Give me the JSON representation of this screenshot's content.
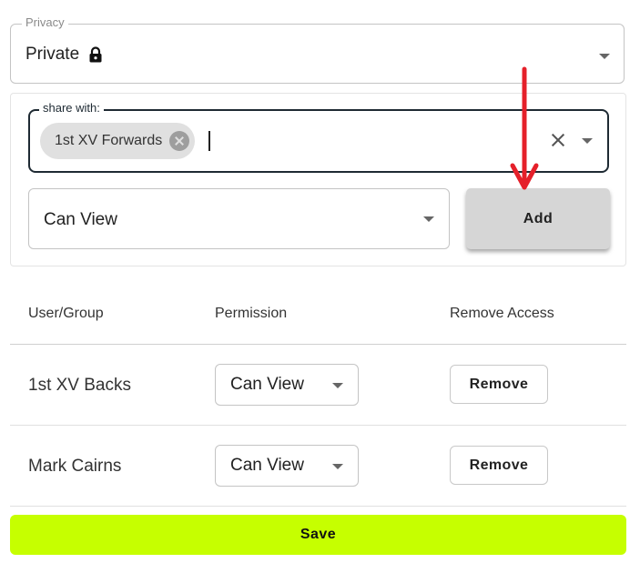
{
  "privacy": {
    "legend": "Privacy",
    "value": "Private",
    "icon": "lock-icon"
  },
  "share_with": {
    "legend": "share with:",
    "chips": [
      {
        "label": "1st XV Forwards"
      }
    ],
    "input_value": ""
  },
  "permission_select": {
    "value": "Can View"
  },
  "add_label": "Add",
  "table": {
    "headers": [
      "User/Group",
      "Permission",
      "Remove Access"
    ],
    "rows": [
      {
        "name": "1st XV Backs",
        "permission": "Can View",
        "action": "Remove"
      },
      {
        "name": "Mark Cairns",
        "permission": "Can View",
        "action": "Remove"
      }
    ]
  },
  "save_label": "Save",
  "colors": {
    "save": "#c6ff00",
    "annotation_arrow": "#e5202a",
    "focused_border": "#1e2a33"
  }
}
